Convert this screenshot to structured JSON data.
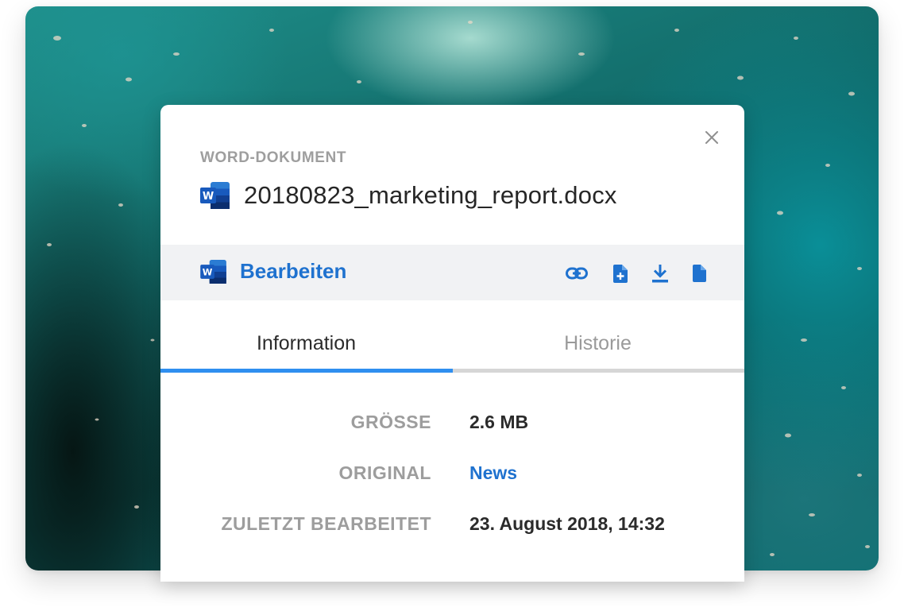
{
  "dialog": {
    "file_type": "WORD-DOKUMENT",
    "file_name": "20180823_marketing_report.docx",
    "file_icon": "word-icon",
    "close_icon": "close-icon"
  },
  "actions": {
    "edit_label": "Bearbeiten",
    "tools": [
      "link-icon",
      "add-file-icon",
      "download-icon",
      "file-icon"
    ]
  },
  "tabs": [
    {
      "label": "Information",
      "active": true
    },
    {
      "label": "Historie",
      "active": false
    }
  ],
  "info": [
    {
      "label": "GRÖSSE",
      "value": "2.6 MB"
    },
    {
      "label": "ORIGINAL",
      "value": "News"
    },
    {
      "label": "ZULETZT BEARBEITET",
      "value": "23. August 2018, 14:32"
    }
  ],
  "colors": {
    "accent": "#1f72cf",
    "tab_active": "#2f8ff0",
    "word_blue": "#185abd"
  }
}
